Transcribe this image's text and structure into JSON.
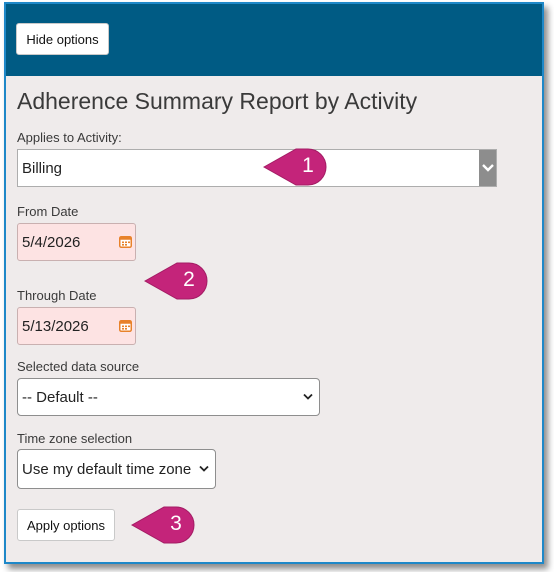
{
  "header": {
    "hide_button": "Hide options"
  },
  "title": "Adherence Summary Report by Activity",
  "activity": {
    "label": "Applies to Activity:",
    "value": "Billing"
  },
  "from_date": {
    "label": "From Date",
    "value": "5/4/2026"
  },
  "through_date": {
    "label": "Through Date",
    "value": "5/13/2026"
  },
  "data_source": {
    "label": "Selected data source",
    "value": "-- Default --"
  },
  "time_zone": {
    "label": "Time zone selection",
    "value": "Use my default time zone"
  },
  "apply_button": "Apply options",
  "callouts": [
    "1",
    "2",
    "3"
  ],
  "colors": {
    "header": "#005b84",
    "callout": "#c4247a",
    "date_bg": "#fde3e3",
    "panel_bg": "#efebeb",
    "date_icon": "#e8822a"
  }
}
